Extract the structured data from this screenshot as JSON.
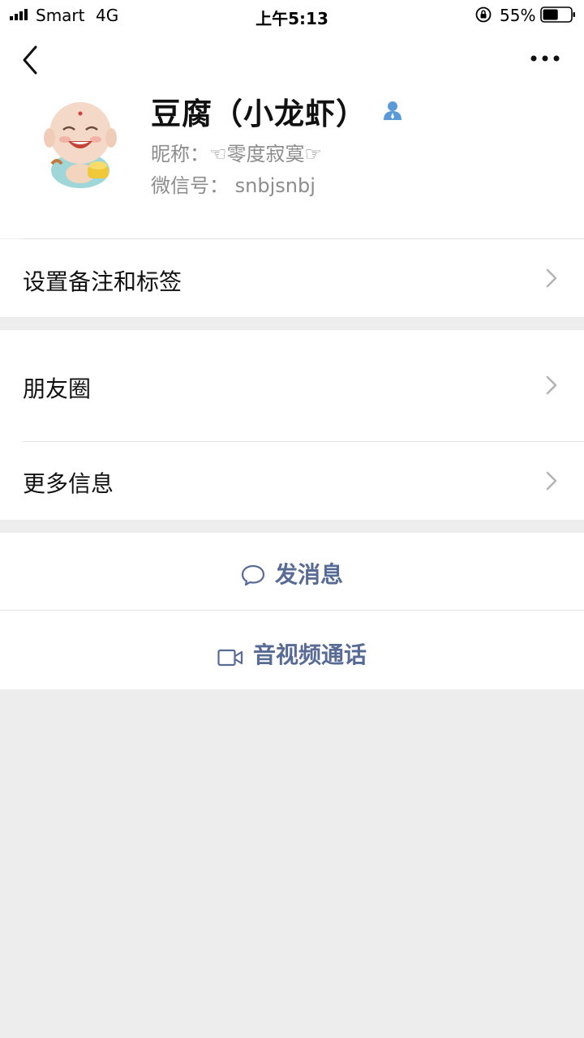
{
  "status_bar": {
    "carrier": "Smart",
    "network": "4G",
    "time": "上午5:13",
    "battery_percent": "55%",
    "battery_level": 0.55,
    "icons": [
      "signal-icon",
      "orientation-lock-icon",
      "battery-icon"
    ]
  },
  "nav": {
    "back_icon": "chevron-left-icon",
    "more_icon": "more-dots-icon"
  },
  "profile": {
    "name": "豆腐（小龙虾）",
    "contact_icon": "person-icon",
    "nickname_line": "昵称：☜零度寂寞☞",
    "wechat_id_line": "微信号：  snbjsnbj"
  },
  "rows": {
    "remark_tags": "设置备注和标签",
    "moments": "朋友圈",
    "more_info": "更多信息"
  },
  "actions": {
    "send_message": "发消息",
    "video_call": "音视频通话"
  },
  "colors": {
    "link_blue": "#576b95",
    "page_bg": "#ededed",
    "secondary_text": "#8c8c8c"
  }
}
